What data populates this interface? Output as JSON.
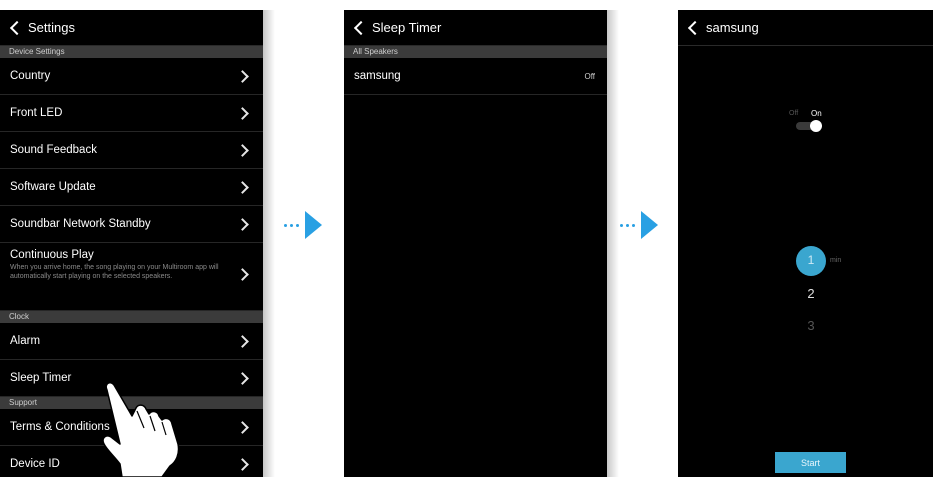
{
  "screen1": {
    "title": "Settings",
    "sections": {
      "device": "Device Settings",
      "clock": "Clock",
      "support": "Support"
    },
    "items": {
      "country": "Country",
      "front_led": "Front LED",
      "sound_feedback": "Sound Feedback",
      "software_update": "Software Update",
      "network_standby": "Soundbar Network Standby",
      "continuous_play": "Continuous Play",
      "continuous_play_desc": "When you arrive home, the song playing on your Multiroom app will automatically start playing on the selected speakers.",
      "alarm": "Alarm",
      "sleep_timer": "Sleep Timer",
      "terms": "Terms & Conditions",
      "device_id": "Device ID"
    }
  },
  "screen2": {
    "title": "Sleep Timer",
    "section": "All Speakers",
    "speaker_name": "samsung",
    "speaker_status": "Off"
  },
  "screen3": {
    "title": "samsung",
    "toggle": {
      "off_label": "Off",
      "on_label": "On",
      "state": "on"
    },
    "picker": {
      "selected": "1",
      "unit": "min",
      "next": "2",
      "next2": "3"
    },
    "start_label": "Start"
  },
  "colors": {
    "accent": "#29a0e3",
    "background": "#000000",
    "section_bar": "#3b3b3b"
  }
}
